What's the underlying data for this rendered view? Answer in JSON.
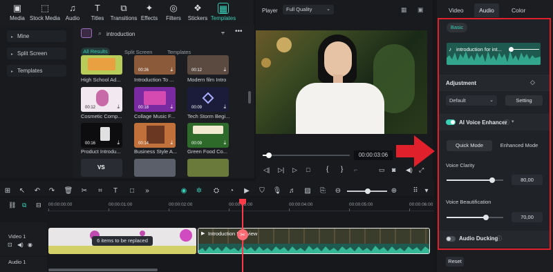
{
  "toolbar": {
    "items": [
      {
        "label": "Media",
        "icon": "media-icon"
      },
      {
        "label": "Stock Media",
        "icon": "stock-media-icon"
      },
      {
        "label": "Audio",
        "icon": "music-note-icon"
      },
      {
        "label": "Titles",
        "icon": "titles-icon"
      },
      {
        "label": "Transitions",
        "icon": "transitions-icon"
      },
      {
        "label": "Effects",
        "icon": "effects-icon"
      },
      {
        "label": "Filters",
        "icon": "filters-icon"
      },
      {
        "label": "Stickers",
        "icon": "stickers-icon"
      },
      {
        "label": "Templates",
        "icon": "templates-icon"
      }
    ]
  },
  "sidebar": {
    "items": [
      {
        "label": "Mine"
      },
      {
        "label": "Split Screen"
      },
      {
        "label": "Templates"
      }
    ]
  },
  "templates": {
    "search_value": "introduction",
    "filters": [
      "All Results",
      "Split Screen",
      "Templates"
    ],
    "active_filter": "All Results",
    "grid": [
      {
        "title": "High School Ad...",
        "time": "",
        "color": "#b3c85a"
      },
      {
        "title": "Introduction To ...",
        "time": "00:26",
        "color": "#8a5a3a"
      },
      {
        "title": "Modern film Intro",
        "time": "00:12",
        "color": "#5a4a40"
      },
      {
        "title": "Cosmetic Comp...",
        "time": "00:12",
        "color": "#f2e8ef"
      },
      {
        "title": "Collage Music F...",
        "time": "00:18",
        "color": "#7a2aa0"
      },
      {
        "title": "Tech Storm Begi...",
        "time": "00:09",
        "color": "#1a1c3a"
      },
      {
        "title": "Product Introdu...",
        "time": "00:16",
        "color": "#0d0d10"
      },
      {
        "title": "Business Style A...",
        "time": "00:14",
        "color": "#c0703a"
      },
      {
        "title": "Green Food Co...",
        "time": "00:09",
        "color": "#2e6a2a"
      },
      {
        "title": "",
        "time": "",
        "color": "#2a2c33"
      },
      {
        "title": "",
        "time": "",
        "color": "#5a5f6a"
      },
      {
        "title": "",
        "time": "",
        "color": "#6a7a3a"
      }
    ]
  },
  "player": {
    "label": "Player",
    "quality": "Full Quality",
    "timecode": "00:00:03:06",
    "progress": 0.07
  },
  "timeline": {
    "rulers": [
      "00:00:00:00",
      "00:00:01:00",
      "00:00:02:00",
      "00:00:03:00",
      "00:00:04:00",
      "00:00:05:00",
      "00:00:06:00"
    ],
    "video_track": "Video 1",
    "audio_track": "Audio 1",
    "clip_tooltip": "6 items to be replaced",
    "clip2_label": "Introduction Interview"
  },
  "right_panel": {
    "tabs": [
      "Video",
      "Audio",
      "Color"
    ],
    "active_tab": "Audio",
    "basic_label": "Basic",
    "audio_clip_name": "introduction for int...",
    "adjustment_label": "Adjustment",
    "preset_value": "Default",
    "setting_label": "Setting",
    "ai_voice_label": "AI Voice Enhancer",
    "quick_mode": "Quick Mode",
    "enhanced_mode": "Enhanced Mode",
    "voice_clarity_label": "Voice Clarity",
    "voice_clarity_value": "80,00",
    "voice_clarity_level": 0.8,
    "voice_beautification_label": "Voice Beautification",
    "voice_beautification_value": "70,00",
    "voice_beautification_level": 0.7,
    "audio_ducking_label": "Audio Ducking",
    "reset_label": "Reset"
  },
  "colors": {
    "accent": "#39d0b8",
    "highlight": "#e0202a",
    "playhead": "#ff3b4a"
  }
}
